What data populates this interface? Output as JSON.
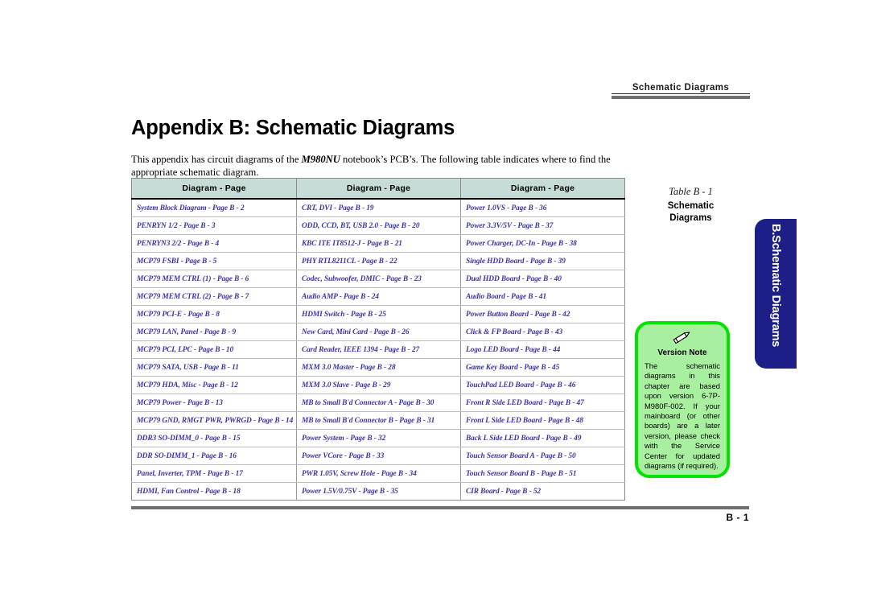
{
  "header": {
    "running_head": "Schematic  Diagrams"
  },
  "title": "Appendix B: Schematic Diagrams",
  "intro": {
    "before_model": "This appendix has circuit diagrams of the ",
    "model": "M980NU",
    "after_model": " notebook’s PCB’s. The following table indicates where to find the appropriate schematic diagram."
  },
  "table": {
    "headers": [
      "Diagram - Page",
      "Diagram - Page",
      "Diagram - Page"
    ],
    "rows": [
      [
        "System Block Diagram - Page  B - 2",
        "CRT, DVI - Page  B - 19",
        "Power 1.0VS - Page  B - 36"
      ],
      [
        "PENRYN 1/2 - Page  B - 3",
        "ODD, CCD, BT, USB 2.0 - Page  B - 20",
        "Power 3.3V/5V - Page  B - 37"
      ],
      [
        "PENRYN3 2/2 - Page  B - 4",
        "KBC ITE IT8512-J - Page  B - 21",
        "Power Charger, DC-In - Page  B - 38"
      ],
      [
        "MCP79 FSBI - Page  B - 5",
        "PHY RTL8211CL - Page  B - 22",
        "Single HDD Board - Page  B - 39"
      ],
      [
        "MCP79 MEM CTRL (1) - Page  B - 6",
        "Codec, Subwoofer, DMIC - Page  B - 23",
        "Dual HDD Board - Page  B - 40"
      ],
      [
        "MCP79 MEM CTRL (2) - Page  B - 7",
        "Audio AMP - Page  B - 24",
        "Audio Board - Page  B - 41"
      ],
      [
        "MCP79 PCI-E - Page  B - 8",
        "HDMI Switch - Page  B - 25",
        "Power Button Board - Page  B - 42"
      ],
      [
        "MCP79 LAN, Panel - Page  B - 9",
        "New Card, Mini Card - Page  B - 26",
        "Click & FP Board - Page  B - 43"
      ],
      [
        "MCP79 PCI, LPC - Page  B - 10",
        "Card Reader, IEEE 1394 - Page  B - 27",
        "Logo LED Board - Page  B - 44"
      ],
      [
        "MCP79 SATA, USB - Page  B - 11",
        "MXM 3.0 Master - Page  B - 28",
        "Game Key Board - Page  B - 45"
      ],
      [
        "MCP79 HDA, Misc - Page  B - 12",
        "MXM 3.0 Slave - Page  B - 29",
        "TouchPad LED Board - Page  B - 46"
      ],
      [
        "MCP79 Power - Page  B - 13",
        "MB to Small B'd Connector A - Page  B - 30",
        "Front R Side LED Board - Page  B - 47"
      ],
      [
        "MCP79 GND, RMGT PWR, PWRGD - Page  B - 14",
        "MB to Small B'd Connector B - Page  B - 31",
        "Front L Side LED Board - Page  B - 48"
      ],
      [
        "DDR3 SO-DIMM_0 - Page  B - 15",
        "Power System - Page  B - 32",
        "Back L Side LED Board - Page  B - 49"
      ],
      [
        "DDR SO-DIMM_1 - Page  B - 16",
        "Power VCore - Page  B - 33",
        "Touch Sensor Board A - Page  B - 50"
      ],
      [
        "Panel, Inverter, TPM - Page  B - 17",
        "PWR 1.05V, Screw Hole - Page  B - 34",
        "Touch Sensor Board B - Page  B - 51"
      ],
      [
        "HDMI, Fan Control - Page  B - 18",
        "Power 1.5V/0.75V - Page  B - 35",
        "CIR Board - Page  B - 52"
      ]
    ]
  },
  "caption": {
    "number": "Table B - 1",
    "title": "Schematic\nDiagrams"
  },
  "chapter_tab": {
    "label": "B.Schematic Diagrams"
  },
  "version_note": {
    "icon": "pencil-icon",
    "title": "Version Note",
    "body": "The schematic diagrams in this chapter are based upon version 6-7P-M980F-002. If your mainboard (or other boards) are a later version, please check with the Service Center for updated diagrams (if required)."
  },
  "footer": {
    "page_number": "B - 1"
  },
  "colors": {
    "table_header_bg": "#c7dcd6",
    "table_entry_text": "#3b33a8",
    "chapter_tab_bg": "#1d1f86",
    "note_border": "#00e400",
    "note_fill": "#a8f0a0",
    "rule_gray": "#6f6f6f"
  }
}
